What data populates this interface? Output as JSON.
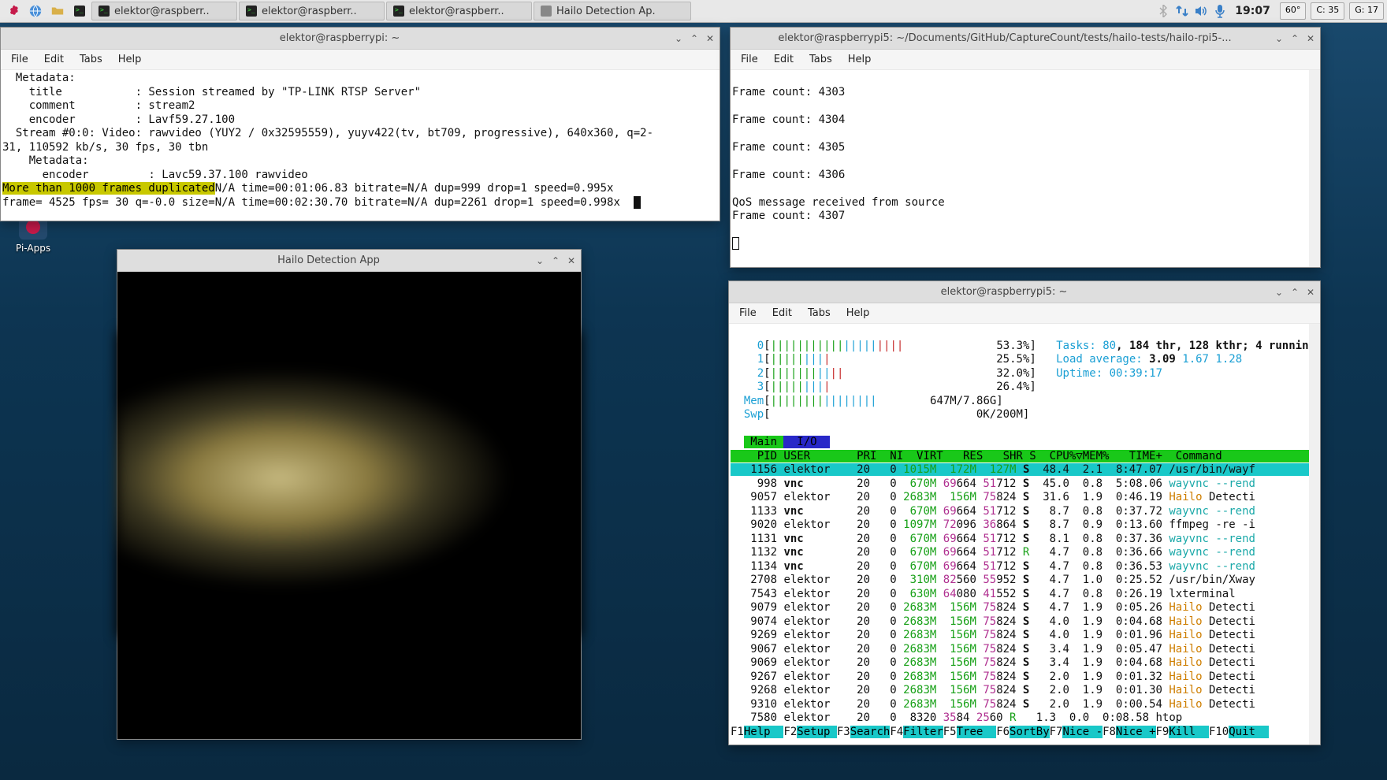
{
  "taskbar": {
    "items": [
      {
        "label": "elektor@raspberr..",
        "icon": "terminal"
      },
      {
        "label": "elektor@raspberr..",
        "icon": "terminal"
      },
      {
        "label": "elektor@raspberr..",
        "icon": "terminal"
      },
      {
        "label": "Hailo Detection Ap.",
        "icon": "app"
      }
    ],
    "clock": "19:07",
    "temp": "60°",
    "cpu": "C: 35",
    "gpu": "G: 17"
  },
  "desktop": {
    "piapps": "Pi-Apps"
  },
  "term1": {
    "title": "elektor@raspberrypi: ~",
    "menu": [
      "File",
      "Edit",
      "Tabs",
      "Help"
    ],
    "lines": [
      "  Metadata:",
      "    title           : Session streamed by \"TP-LINK RTSP Server\"",
      "    comment         : stream2",
      "    encoder         : Lavf59.27.100",
      "  Stream #0:0: Video: rawvideo (YUY2 / 0x32595559), yuyv422(tv, bt709, progressive), 640x360, q=2-",
      "31, 110592 kb/s, 30 fps, 30 tbn",
      "    Metadata:",
      "      encoder         : Lavc59.37.100 rawvideo"
    ],
    "warn_line_pre": "More than 1000 frames duplicated",
    "warn_line_post": "N/A time=00:01:06.83 bitrate=N/A dup=999 drop=1 speed=0.995x",
    "last_line": "frame= 4525 fps= 30 q=-0.0 size=N/A time=00:02:30.70 bitrate=N/A dup=2261 drop=1 speed=0.998x"
  },
  "hailo": {
    "title": "Hailo Detection App"
  },
  "term2": {
    "title": "elektor@raspberrypi5: ~/Documents/GitHub/CaptureCount/tests/hailo-tests/hailo-rpi5-...",
    "menu": [
      "File",
      "Edit",
      "Tabs",
      "Help"
    ],
    "lines": [
      "",
      "Frame count: 4303",
      "",
      "Frame count: 4304",
      "",
      "Frame count: 4305",
      "",
      "Frame count: 4306",
      "",
      "QoS message received from source",
      "Frame count: 4307"
    ]
  },
  "term3": {
    "title": "elektor@raspberrypi5: ~",
    "menu": [
      "File",
      "Edit",
      "Tabs",
      "Help"
    ],
    "cpus": [
      {
        "n": "0",
        "bar": "||||||||||||||||||||",
        "pct": "53.3%"
      },
      {
        "n": "1",
        "bar": "|||||||||",
        "pct": "25.5%"
      },
      {
        "n": "2",
        "bar": "|||||||||||",
        "pct": "32.0%"
      },
      {
        "n": "3",
        "bar": "|||||||||",
        "pct": "26.4%"
      }
    ],
    "mem_bar": "||||||||||||||||",
    "mem": "647M/7.86G",
    "swp": "0K/200M",
    "tasks_label": "Tasks: ",
    "tasks": "80",
    "thr": ", 184 thr, 128 kthr; 4 runnin",
    "load_label": "Load average: ",
    "load_main": "3.09",
    "load_rest": " 1.67 1.28",
    "uptime_label": "Uptime: ",
    "uptime": "00:39:17",
    "tabs": {
      "main": "Main",
      "io": "I/O"
    },
    "columns": "    PID USER       PRI  NI  VIRT   RES   SHR S  CPU%▽MEM%   TIME+  Command      ",
    "rows": [
      {
        "pid": "1156",
        "user": "elektor",
        "pri": "20",
        "ni": "0",
        "virt": "1015M",
        "res": "172M",
        "shr": "127M",
        "s": "S",
        "cpu": "48.4",
        "mem": "2.1",
        "time": "8:47.07",
        "cmd": "/usr/bin/wayf",
        "hl": true
      },
      {
        "pid": "998",
        "user": "vnc",
        "pri": "20",
        "ni": "0",
        "virt": "670M",
        "res": "69664",
        "shr": "51712",
        "s": "S",
        "cpu": "45.0",
        "mem": "0.8",
        "time": "5:08.06",
        "cmd": "wayvnc --rend",
        "vnc": true,
        "cyan": true
      },
      {
        "pid": "9057",
        "user": "elektor",
        "pri": "20",
        "ni": "0",
        "virt": "2683M",
        "res": "156M",
        "shr": "75824",
        "s": "S",
        "cpu": "31.6",
        "mem": "1.9",
        "time": "0:46.19",
        "cmd": "Hailo Detecti",
        "hailo": true
      },
      {
        "pid": "1133",
        "user": "vnc",
        "pri": "20",
        "ni": "0",
        "virt": "670M",
        "res": "69664",
        "shr": "51712",
        "s": "S",
        "cpu": "8.7",
        "mem": "0.8",
        "time": "0:37.72",
        "cmd": "wayvnc --rend",
        "vnc": true,
        "cyan": true
      },
      {
        "pid": "9020",
        "user": "elektor",
        "pri": "20",
        "ni": "0",
        "virt": "1097M",
        "res": "72096",
        "shr": "36864",
        "s": "S",
        "cpu": "8.7",
        "mem": "0.9",
        "time": "0:13.60",
        "cmd": "ffmpeg -re -i"
      },
      {
        "pid": "1131",
        "user": "vnc",
        "pri": "20",
        "ni": "0",
        "virt": "670M",
        "res": "69664",
        "shr": "51712",
        "s": "S",
        "cpu": "8.1",
        "mem": "0.8",
        "time": "0:37.36",
        "cmd": "wayvnc --rend",
        "vnc": true,
        "cyan": true
      },
      {
        "pid": "1132",
        "user": "vnc",
        "pri": "20",
        "ni": "0",
        "virt": "670M",
        "res": "69664",
        "shr": "51712",
        "s": "R",
        "cpu": "4.7",
        "mem": "0.8",
        "time": "0:36.66",
        "cmd": "wayvnc --rend",
        "vnc": true,
        "cyan": true,
        "running": true
      },
      {
        "pid": "1134",
        "user": "vnc",
        "pri": "20",
        "ni": "0",
        "virt": "670M",
        "res": "69664",
        "shr": "51712",
        "s": "S",
        "cpu": "4.7",
        "mem": "0.8",
        "time": "0:36.53",
        "cmd": "wayvnc --rend",
        "vnc": true,
        "cyan": true
      },
      {
        "pid": "2708",
        "user": "elektor",
        "pri": "20",
        "ni": "0",
        "virt": "310M",
        "res": "82560",
        "shr": "55952",
        "s": "S",
        "cpu": "4.7",
        "mem": "1.0",
        "time": "0:25.52",
        "cmd": "/usr/bin/Xway"
      },
      {
        "pid": "7543",
        "user": "elektor",
        "pri": "20",
        "ni": "0",
        "virt": "630M",
        "res": "64080",
        "shr": "41552",
        "s": "S",
        "cpu": "4.7",
        "mem": "0.8",
        "time": "0:26.19",
        "cmd": "lxterminal"
      },
      {
        "pid": "9079",
        "user": "elektor",
        "pri": "20",
        "ni": "0",
        "virt": "2683M",
        "res": "156M",
        "shr": "75824",
        "s": "S",
        "cpu": "4.7",
        "mem": "1.9",
        "time": "0:05.26",
        "cmd": "Hailo Detecti",
        "hailo": true
      },
      {
        "pid": "9074",
        "user": "elektor",
        "pri": "20",
        "ni": "0",
        "virt": "2683M",
        "res": "156M",
        "shr": "75824",
        "s": "S",
        "cpu": "4.0",
        "mem": "1.9",
        "time": "0:04.68",
        "cmd": "Hailo Detecti",
        "hailo": true
      },
      {
        "pid": "9269",
        "user": "elektor",
        "pri": "20",
        "ni": "0",
        "virt": "2683M",
        "res": "156M",
        "shr": "75824",
        "s": "S",
        "cpu": "4.0",
        "mem": "1.9",
        "time": "0:01.96",
        "cmd": "Hailo Detecti",
        "hailo": true
      },
      {
        "pid": "9067",
        "user": "elektor",
        "pri": "20",
        "ni": "0",
        "virt": "2683M",
        "res": "156M",
        "shr": "75824",
        "s": "S",
        "cpu": "3.4",
        "mem": "1.9",
        "time": "0:05.47",
        "cmd": "Hailo Detecti",
        "hailo": true
      },
      {
        "pid": "9069",
        "user": "elektor",
        "pri": "20",
        "ni": "0",
        "virt": "2683M",
        "res": "156M",
        "shr": "75824",
        "s": "S",
        "cpu": "3.4",
        "mem": "1.9",
        "time": "0:04.68",
        "cmd": "Hailo Detecti",
        "hailo": true
      },
      {
        "pid": "9267",
        "user": "elektor",
        "pri": "20",
        "ni": "0",
        "virt": "2683M",
        "res": "156M",
        "shr": "75824",
        "s": "S",
        "cpu": "2.0",
        "mem": "1.9",
        "time": "0:01.32",
        "cmd": "Hailo Detecti",
        "hailo": true
      },
      {
        "pid": "9268",
        "user": "elektor",
        "pri": "20",
        "ni": "0",
        "virt": "2683M",
        "res": "156M",
        "shr": "75824",
        "s": "S",
        "cpu": "2.0",
        "mem": "1.9",
        "time": "0:01.30",
        "cmd": "Hailo Detecti",
        "hailo": true
      },
      {
        "pid": "9310",
        "user": "elektor",
        "pri": "20",
        "ni": "0",
        "virt": "2683M",
        "res": "156M",
        "shr": "75824",
        "s": "S",
        "cpu": "2.0",
        "mem": "1.9",
        "time": "0:00.54",
        "cmd": "Hailo Detecti",
        "hailo": true
      },
      {
        "pid": "7580",
        "user": "elektor",
        "pri": "20",
        "ni": "0",
        "virt": "8320",
        "res": "3584",
        "shr": "2560",
        "s": "R",
        "cpu": "1.3",
        "mem": "0.0",
        "time": "0:08.58",
        "cmd": "htop",
        "running": true
      }
    ],
    "fkeys": [
      {
        "k": "F1",
        "l": "Help  "
      },
      {
        "k": "F2",
        "l": "Setup "
      },
      {
        "k": "F3",
        "l": "Search"
      },
      {
        "k": "F4",
        "l": "Filter"
      },
      {
        "k": "F5",
        "l": "Tree  "
      },
      {
        "k": "F6",
        "l": "SortBy"
      },
      {
        "k": "F7",
        "l": "Nice -"
      },
      {
        "k": "F8",
        "l": "Nice +"
      },
      {
        "k": "F9",
        "l": "Kill  "
      },
      {
        "k": "F10",
        "l": "Quit  "
      }
    ]
  }
}
